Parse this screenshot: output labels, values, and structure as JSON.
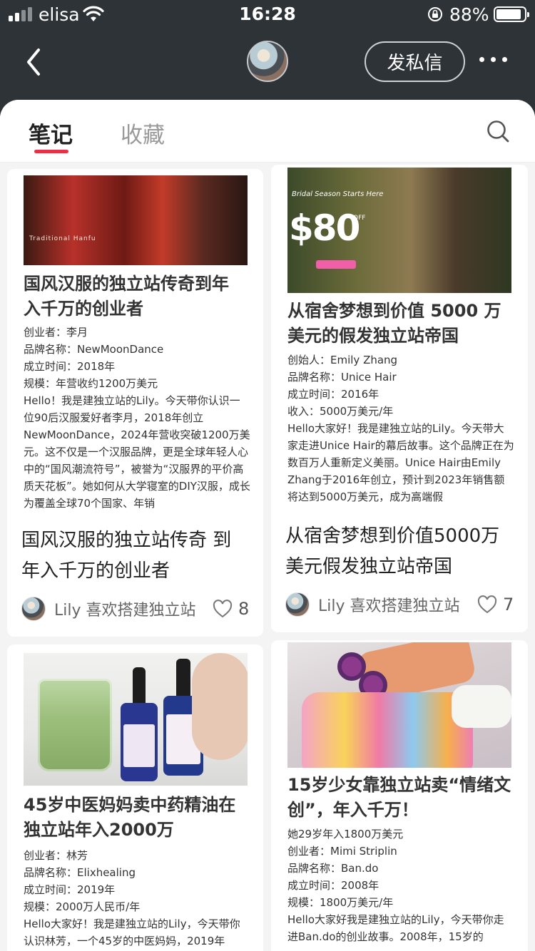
{
  "status": {
    "carrier": "elisa",
    "time": "16:28",
    "battery": "88%"
  },
  "nav": {
    "dm_button": "发私信"
  },
  "tabs": {
    "notes": "笔记",
    "favorites": "收藏"
  },
  "cards": [
    {
      "title": "国风汉服的独立站传奇到年入千万的创业者",
      "image_caption": "Traditional Hanfu",
      "body": "创业者：李月\n品牌名称：NewMoonDance\n成立时间：2018年\n规模：年营收约1200万美元\nHello！我是建独立站的Lily。今天带你认识一位90后汉服爱好者李月，2018年创立NewMoonDance，2024年营收突破1200万美元。这不仅是一个汉服品牌，更是全球年轻人心中的“国风潮流符号”，被誉为“汉服界的平价高质天花板”。她如何从大学寝室的DIY汉服，成长为覆盖全球70个国家、年销",
      "caption": "国风汉服的独立站传奇 到年入千万的创业者",
      "author": "Lily 喜欢搭建独立站",
      "likes": "8"
    },
    {
      "title": "从宿舍梦想到价值 5000 万美元的假发独立站帝国",
      "image_text": {
        "tagline": "Bridal Season Starts Here",
        "price": "$80",
        "off": "OFF"
      },
      "body": "创始人：Emily Zhang\n品牌名称：Unice Hair\n成立时间：2016年\n收入：5000万美元/年\nHello大家好！我是建独立站的Lily。今天带大家走进Unice Hair的幕后故事。这个品牌正在为数百万人重新定义美丽。Unice Hair由Emily Zhang于2016年创立，预计到2023年销售额将达到5000万美元，成为高端假",
      "caption": "从宿舍梦想到价值5000万美元假发独立站帝国",
      "author": "Lily 喜欢搭建独立站",
      "likes": "7"
    },
    {
      "title": "45岁中医妈妈卖中药精油在独立站年入2000万",
      "body": "创业者：林芳\n品牌名称：Elixhealing\n成立时间：2019年\n规模：2000万人民币/年\nHello大家好！我是建独立站的Lily，今天带你认识林芳，一个45岁的中医妈妈，2019年"
    },
    {
      "title": "15岁少女靠独立站卖“情绪文创”，年入千万！",
      "body": "她29岁年入1800万美元\n创业者：Mimi Striplin\n品牌名称：Ban.do\n成立时间：2008年\n规模：1800万美元/年\nHello大家好我是建独立站的Lily，今天带你走进Ban.do的创业故事。2008年，15岁的"
    }
  ]
}
